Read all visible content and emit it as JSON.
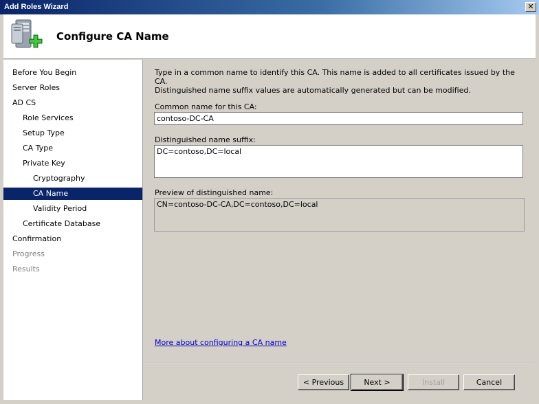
{
  "window": {
    "title": "Add Roles Wizard",
    "close_glyph": "✕"
  },
  "header": {
    "title": "Configure CA Name",
    "icon": "server-roles-add-icon"
  },
  "nav": {
    "items": [
      {
        "label": "Before You Begin",
        "level": 0,
        "state": "normal"
      },
      {
        "label": "Server Roles",
        "level": 0,
        "state": "normal"
      },
      {
        "label": "AD CS",
        "level": 0,
        "state": "normal"
      },
      {
        "label": "Role Services",
        "level": 1,
        "state": "normal"
      },
      {
        "label": "Setup Type",
        "level": 1,
        "state": "normal"
      },
      {
        "label": "CA Type",
        "level": 1,
        "state": "normal"
      },
      {
        "label": "Private Key",
        "level": 1,
        "state": "normal"
      },
      {
        "label": "Cryptography",
        "level": 2,
        "state": "normal"
      },
      {
        "label": "CA Name",
        "level": 2,
        "state": "selected"
      },
      {
        "label": "Validity Period",
        "level": 2,
        "state": "normal"
      },
      {
        "label": "Certificate Database",
        "level": 1,
        "state": "normal"
      },
      {
        "label": "Confirmation",
        "level": 0,
        "state": "normal"
      },
      {
        "label": "Progress",
        "level": 0,
        "state": "disabled"
      },
      {
        "label": "Results",
        "level": 0,
        "state": "disabled"
      }
    ]
  },
  "main": {
    "description_line1": "Type in a common name to identify this CA. This name is added to all certificates issued by the CA.",
    "description_line2": "Distinguished name suffix values are automatically generated but can be modified.",
    "common_name_label": "Common name for this CA:",
    "common_name_value": "contoso-DC-CA",
    "dn_suffix_label": "Distinguished name suffix:",
    "dn_suffix_value": "DC=contoso,DC=local",
    "preview_label": "Preview of distinguished name:",
    "preview_value": "CN=contoso-DC-CA,DC=contoso,DC=local",
    "help_link": "More about configuring a CA name"
  },
  "footer": {
    "previous_label": "< Previous",
    "next_label": "Next >",
    "install_label": "Install",
    "cancel_label": "Cancel"
  }
}
